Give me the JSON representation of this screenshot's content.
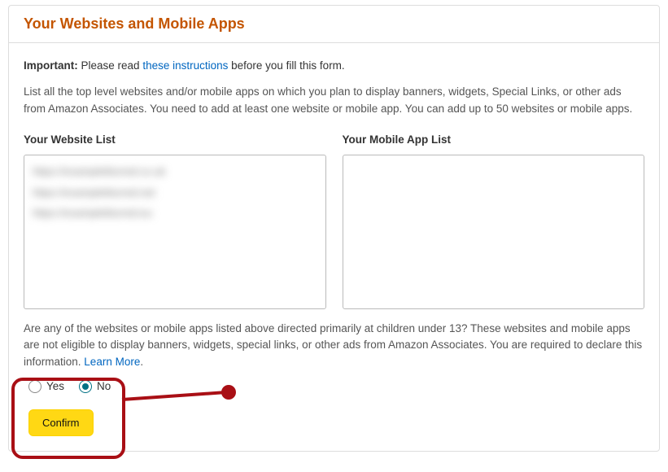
{
  "header": {
    "title": "Your Websites and Mobile Apps"
  },
  "important": {
    "label": "Important:",
    "pre": " Please read ",
    "link": "these instructions",
    "post": " before you fill this form."
  },
  "description": "List all the top level websites and/or mobile apps on which you plan to display banners, widgets, Special Links, or other ads from Amazon Associates. You need to add at least one website or mobile app. You can add up to 50 websites or mobile apps.",
  "website_list": {
    "label": "Your Website List",
    "items": [
      "https://exampleblurred.co.uk",
      "https://exampleblurred.net",
      "https://exampleblurred.eu"
    ]
  },
  "mobile_list": {
    "label": "Your Mobile App List",
    "items": []
  },
  "question": {
    "text": "Are any of the websites or mobile apps listed above directed primarily at children under 13? These websites and mobile apps are not eligible to display banners, widgets, special links, or other ads from Amazon Associates. You are required to declare this information. ",
    "learn_more": "Learn More",
    "period": "."
  },
  "radio": {
    "yes": "Yes",
    "no": "No",
    "selected": "no"
  },
  "confirm": "Confirm"
}
